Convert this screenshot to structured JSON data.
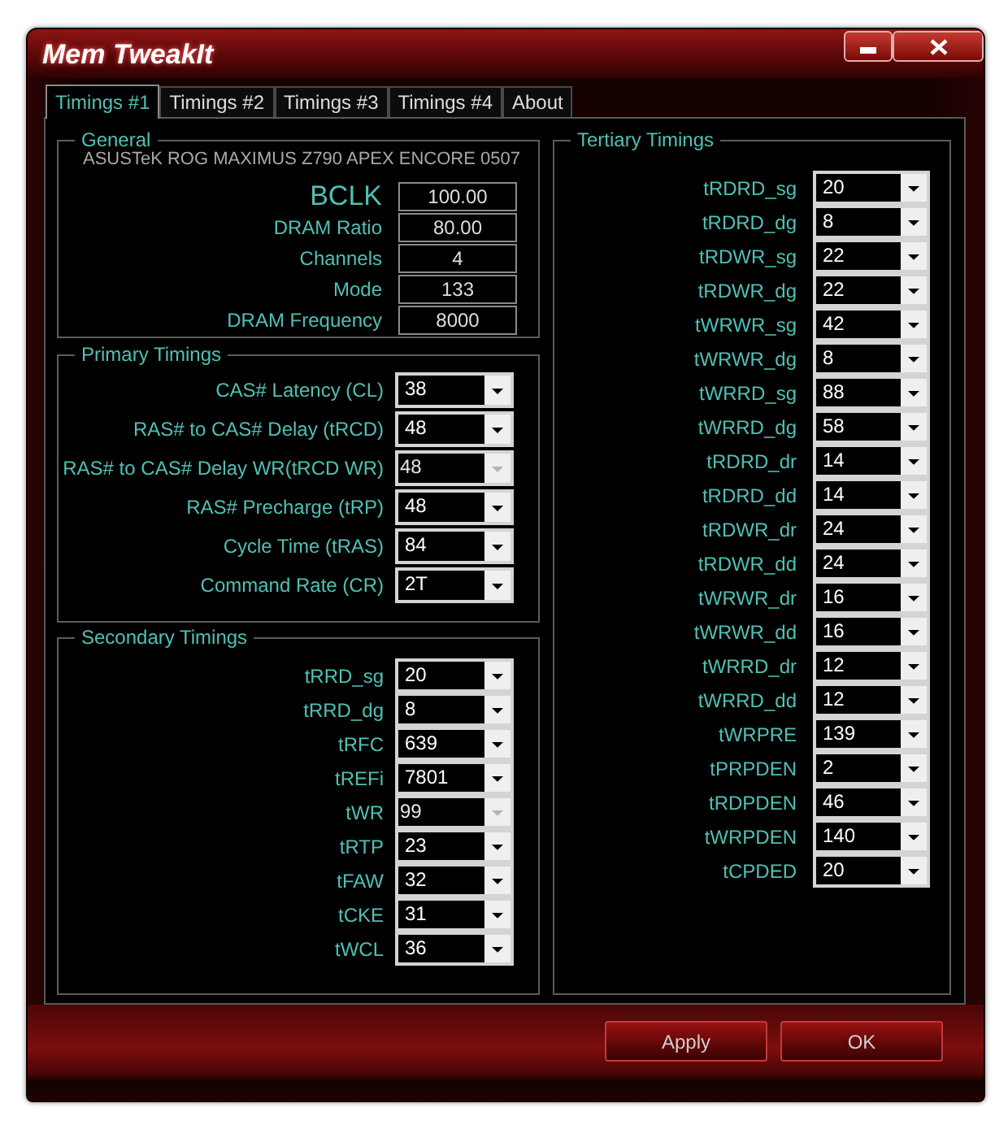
{
  "window": {
    "title": "Mem TweakIt"
  },
  "tabs": [
    {
      "label": "Timings #1",
      "selected": true
    },
    {
      "label": "Timings #2",
      "selected": false
    },
    {
      "label": "Timings #3",
      "selected": false
    },
    {
      "label": "Timings #4",
      "selected": false
    },
    {
      "label": "About",
      "selected": false
    }
  ],
  "general": {
    "title": "General",
    "board": "ASUSTeK ROG MAXIMUS Z790 APEX ENCORE 0507",
    "fields": [
      {
        "label": "BCLK",
        "value": "100.00",
        "kind": "large"
      },
      {
        "label": "DRAM Ratio",
        "value": "80.00",
        "kind": "normal"
      },
      {
        "label": "Channels",
        "value": "4",
        "kind": "normal"
      },
      {
        "label": "Mode",
        "value": "133",
        "kind": "normal"
      },
      {
        "label": "DRAM Frequency",
        "value": "8000",
        "kind": "normal"
      }
    ]
  },
  "primary": {
    "title": "Primary Timings",
    "rows": [
      {
        "label": "CAS# Latency (CL)",
        "value": "38",
        "disabled": false
      },
      {
        "label": "RAS# to CAS# Delay (tRCD)",
        "value": "48",
        "disabled": false
      },
      {
        "label": "RAS# to CAS# Delay WR(tRCD WR)",
        "value": "48",
        "disabled": true
      },
      {
        "label": "RAS# Precharge (tRP)",
        "value": "48",
        "disabled": false
      },
      {
        "label": "Cycle Time (tRAS)",
        "value": "84",
        "disabled": false
      },
      {
        "label": "Command Rate (CR)",
        "value": "2T",
        "disabled": false
      }
    ]
  },
  "secondary": {
    "title": "Secondary Timings",
    "rows": [
      {
        "label": "tRRD_sg",
        "value": "20",
        "disabled": false
      },
      {
        "label": "tRRD_dg",
        "value": "8",
        "disabled": false
      },
      {
        "label": "tRFC",
        "value": "639",
        "disabled": false
      },
      {
        "label": "tREFi",
        "value": "7801",
        "disabled": false
      },
      {
        "label": "tWR",
        "value": "99",
        "disabled": true
      },
      {
        "label": "tRTP",
        "value": "23",
        "disabled": false
      },
      {
        "label": "tFAW",
        "value": "32",
        "disabled": false
      },
      {
        "label": "tCKE",
        "value": "31",
        "disabled": false
      },
      {
        "label": "tWCL",
        "value": "36",
        "disabled": false
      }
    ]
  },
  "tertiary": {
    "title": "Tertiary Timings",
    "rows": [
      {
        "label": "tRDRD_sg",
        "value": "20",
        "disabled": false
      },
      {
        "label": "tRDRD_dg",
        "value": "8",
        "disabled": false
      },
      {
        "label": "tRDWR_sg",
        "value": "22",
        "disabled": false
      },
      {
        "label": "tRDWR_dg",
        "value": "22",
        "disabled": false
      },
      {
        "label": "tWRWR_sg",
        "value": "42",
        "disabled": false
      },
      {
        "label": "tWRWR_dg",
        "value": "8",
        "disabled": false
      },
      {
        "label": "tWRRD_sg",
        "value": "88",
        "disabled": false
      },
      {
        "label": "tWRRD_dg",
        "value": "58",
        "disabled": false
      },
      {
        "label": "tRDRD_dr",
        "value": "14",
        "disabled": false
      },
      {
        "label": "tRDRD_dd",
        "value": "14",
        "disabled": false
      },
      {
        "label": "tRDWR_dr",
        "value": "24",
        "disabled": false
      },
      {
        "label": "tRDWR_dd",
        "value": "24",
        "disabled": false
      },
      {
        "label": "tWRWR_dr",
        "value": "16",
        "disabled": false
      },
      {
        "label": "tWRWR_dd",
        "value": "16",
        "disabled": false
      },
      {
        "label": "tWRRD_dr",
        "value": "12",
        "disabled": false
      },
      {
        "label": "tWRRD_dd",
        "value": "12",
        "disabled": false
      },
      {
        "label": "tWRPRE",
        "value": "139",
        "disabled": false
      },
      {
        "label": "tPRPDEN",
        "value": "2",
        "disabled": false
      },
      {
        "label": "tRDPDEN",
        "value": "46",
        "disabled": false
      },
      {
        "label": "tWRPDEN",
        "value": "140",
        "disabled": false
      },
      {
        "label": "tCPDED",
        "value": "20",
        "disabled": false
      }
    ]
  },
  "buttons": [
    {
      "label": "Apply"
    },
    {
      "label": "OK"
    }
  ]
}
